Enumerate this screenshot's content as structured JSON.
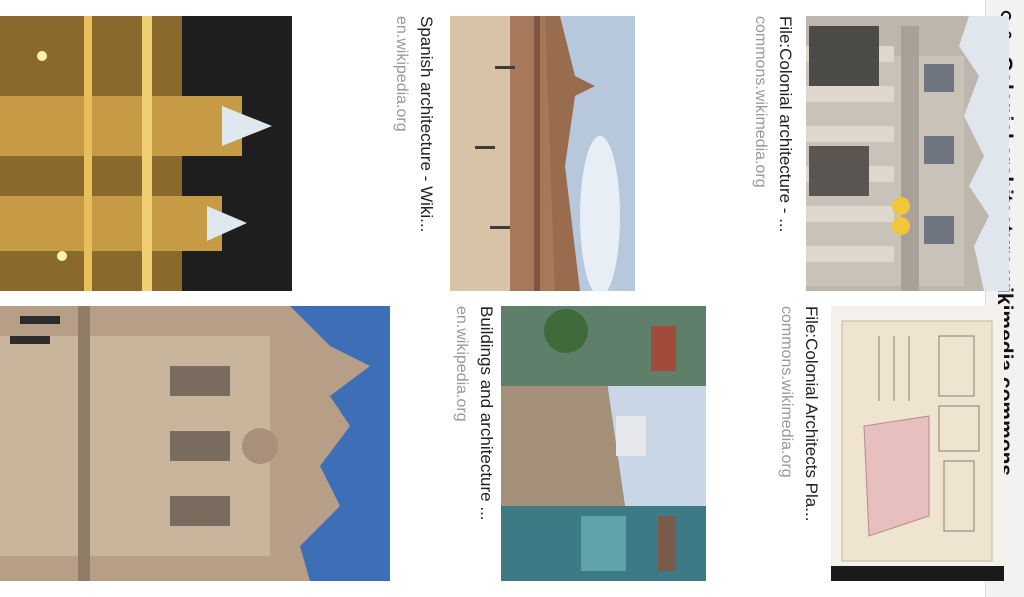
{
  "header": {
    "title": "Colonial architecture wikimedia commons",
    "search_icon": "search-icon",
    "lock_icon": "lock-icon"
  },
  "results": [
    {
      "caption": "File:Colonial architecture - ...",
      "source": "commons.wikimedia.org",
      "image": "ornate-stone-building-facade"
    },
    {
      "caption": "Spanish architecture - Wiki...",
      "source": "en.wikipedia.org",
      "image": "plaza-de-espana-seville"
    },
    {
      "caption": "",
      "source": "",
      "image": "illuminated-cathedral-towers-at-night"
    },
    {
      "caption": "File:Colonial Architects Pla...",
      "source": "commons.wikimedia.org",
      "image": "architectural-plan-drawing"
    },
    {
      "caption": "Buildings and architecture ...",
      "source": "en.wikipedia.org",
      "image": "colonial-street-with-balconies"
    },
    {
      "caption": "",
      "source": "",
      "image": "baroque-church-facade-blue-sky"
    }
  ]
}
